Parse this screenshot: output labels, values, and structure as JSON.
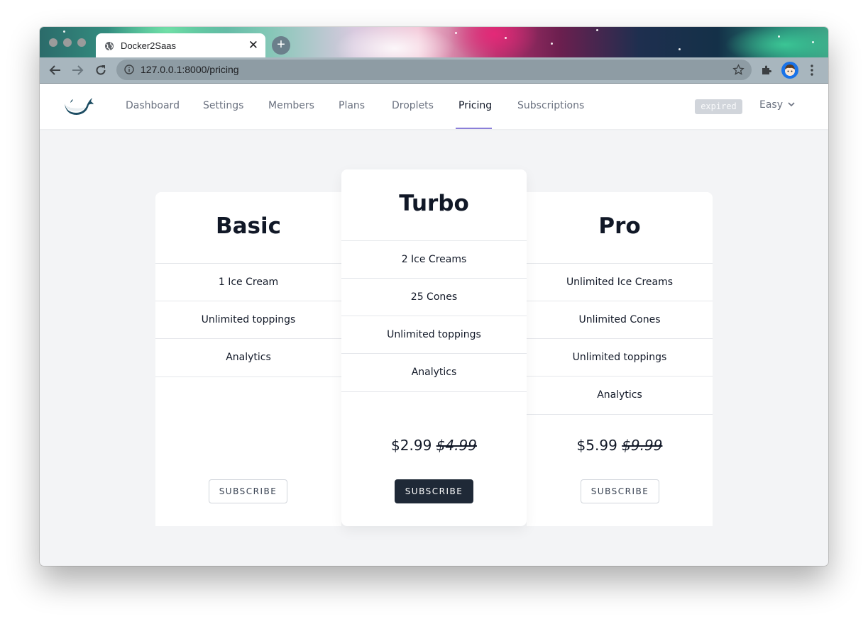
{
  "browser": {
    "tab_title": "Docker2Saas",
    "tab_close": "✕",
    "new_tab": "+",
    "url": "127.0.0.1:8000/pricing"
  },
  "nav": {
    "items": [
      "Dashboard",
      "Settings",
      "Members",
      "Plans",
      "Droplets",
      "Pricing",
      "Subscriptions"
    ],
    "active": "Pricing",
    "badge": "expired",
    "user": "Easy"
  },
  "plans": [
    {
      "name": "Basic",
      "features": [
        "1 Ice Cream",
        "Unlimited toppings",
        "Analytics"
      ],
      "price": "",
      "old_price": "",
      "button": "SUBSCRIBE"
    },
    {
      "name": "Turbo",
      "features": [
        "2 Ice Creams",
        "25 Cones",
        "Unlimited toppings",
        "Analytics"
      ],
      "price": "$2.99",
      "old_price": "$4.99",
      "button": "SUBSCRIBE"
    },
    {
      "name": "Pro",
      "features": [
        "Unlimited Ice Creams",
        "Unlimited Cones",
        "Unlimited toppings",
        "Analytics"
      ],
      "price": "$5.99",
      "old_price": "$9.99",
      "button": "SUBSCRIBE"
    }
  ],
  "colors": {
    "accent_underline": "#8b7fd9",
    "primary_button": "#1f2937",
    "page_background": "#f3f4f6"
  }
}
